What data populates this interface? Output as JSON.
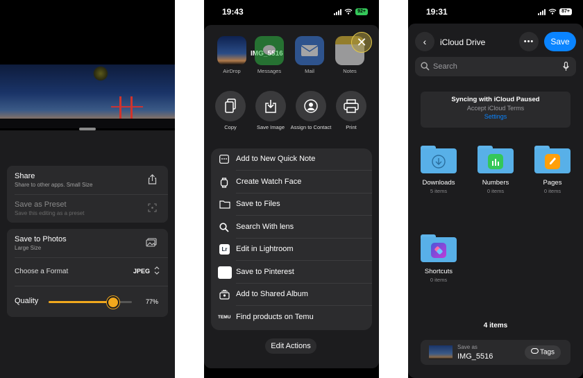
{
  "panel1": {
    "share": {
      "title": "Share",
      "subtitle": "Share to other apps. Small Size",
      "icon": "share-icon"
    },
    "preset": {
      "title": "Save as Preset",
      "subtitle": "Save this editing as a preset",
      "icon": "crop-icon"
    },
    "photos": {
      "title": "Save to Photos",
      "subtitle": "Large Size",
      "icon": "photos-icon"
    },
    "format": {
      "label": "Choose a Format",
      "value": "JPEG"
    },
    "quality": {
      "label": "Quality",
      "value": 0.77,
      "value_text": "77%"
    },
    "accent": "#f1a81d"
  },
  "panel2": {
    "time": "19:43",
    "battery": "92+",
    "apps": [
      {
        "label": "AirDrop",
        "icon": "airdrop-photo-icon"
      },
      {
        "label": "Messages",
        "icon": "messages-icon"
      },
      {
        "label": "Mail",
        "icon": "mail-icon"
      },
      {
        "label": "Notes",
        "icon": "notes-icon"
      }
    ],
    "preview_name": "IMG_5516",
    "actions": [
      {
        "label": "Copy",
        "icon": "copy-icon"
      },
      {
        "label": "Save Image",
        "icon": "save-image-icon"
      },
      {
        "label": "Assign to Contact",
        "icon": "contact-icon"
      },
      {
        "label": "Print",
        "icon": "print-icon"
      }
    ],
    "menu": [
      {
        "label": "Add to New Quick Note",
        "icon": "quick-note-icon"
      },
      {
        "label": "Create Watch Face",
        "icon": "watch-icon"
      },
      {
        "label": "Save to Files",
        "icon": "folder-icon"
      },
      {
        "label": "Search With lens",
        "icon": "search-icon"
      },
      {
        "label": "Edit in Lightroom",
        "icon": "lightroom-icon",
        "badge": "Lr"
      },
      {
        "label": "Save to Pinterest",
        "icon": "pinterest-icon"
      },
      {
        "label": "Add to Shared Album",
        "icon": "shared-album-icon"
      },
      {
        "label": "Find products on Temu",
        "icon": "temu-icon",
        "badge": "TEMU"
      }
    ],
    "edit_actions": "Edit Actions"
  },
  "panel3": {
    "time": "19:31",
    "battery": "87+",
    "title": "iCloud Drive",
    "save_label": "Save",
    "search_placeholder": "Search",
    "banner": {
      "title": "Syncing with iCloud Paused",
      "subtitle": "Accept iCloud Terms",
      "link": "Settings"
    },
    "folders": [
      {
        "name": "Downloads",
        "count": "5 items",
        "icon": "downloads-folder-icon"
      },
      {
        "name": "Numbers",
        "count": "0 items",
        "icon": "numbers-folder-icon"
      },
      {
        "name": "Pages",
        "count": "0 items",
        "icon": "pages-folder-icon"
      },
      {
        "name": "Shortcuts",
        "count": "0 items",
        "icon": "shortcuts-folder-icon"
      }
    ],
    "items_count": "4 items",
    "save_as_label": "Save as",
    "filename": "IMG_5516",
    "tags_label": "Tags",
    "link_color": "#0a84ff"
  }
}
